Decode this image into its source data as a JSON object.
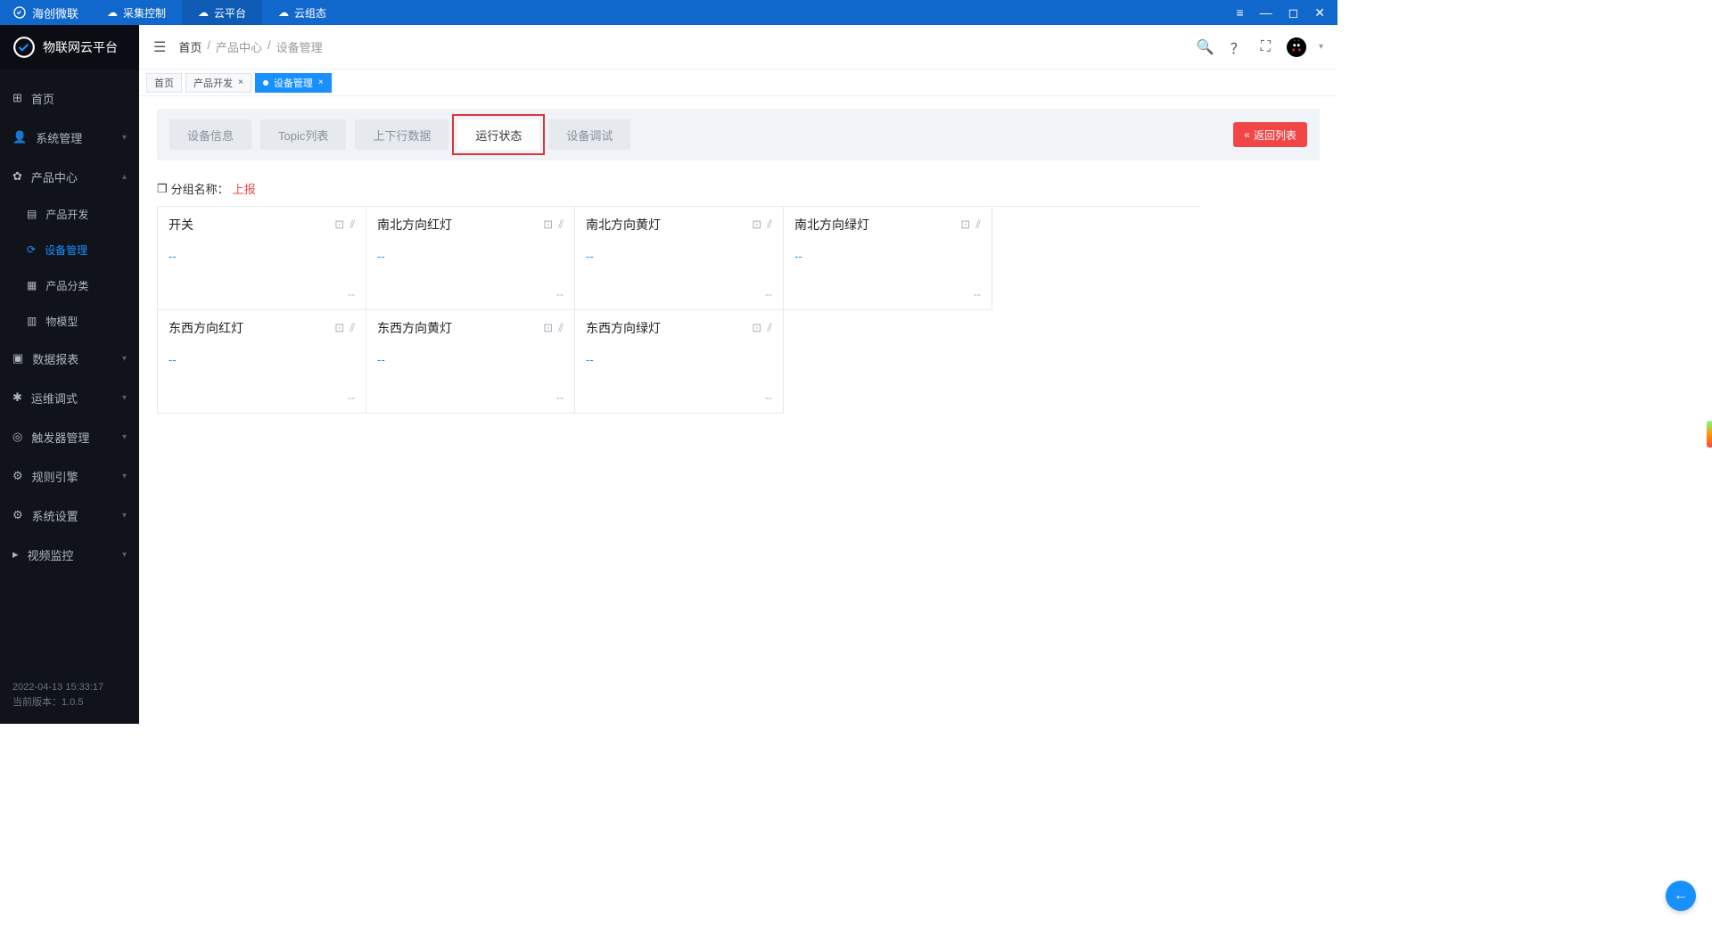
{
  "titlebar": {
    "brand": "海创微联",
    "tabs": [
      {
        "label": "采集控制"
      },
      {
        "label": "云平台",
        "active": true
      },
      {
        "label": "云组态"
      }
    ]
  },
  "sidebar": {
    "logo": "物联网云平台",
    "menu": [
      {
        "label": "首页",
        "icon": "dashboard"
      },
      {
        "label": "系统管理",
        "icon": "user",
        "caret": "down"
      },
      {
        "label": "产品中心",
        "icon": "gear",
        "caret": "up",
        "sub": [
          {
            "label": "产品开发",
            "icon": "list"
          },
          {
            "label": "设备管理",
            "icon": "refresh",
            "active": true
          },
          {
            "label": "产品分类",
            "icon": "grid"
          },
          {
            "label": "物模型",
            "icon": "table"
          }
        ]
      },
      {
        "label": "数据报表",
        "icon": "report",
        "caret": "down"
      },
      {
        "label": "运维调式",
        "icon": "wrench",
        "caret": "down"
      },
      {
        "label": "触发器管理",
        "icon": "trigger",
        "caret": "down"
      },
      {
        "label": "规则引擎",
        "icon": "rule",
        "caret": "down"
      },
      {
        "label": "系统设置",
        "icon": "cog",
        "caret": "down"
      },
      {
        "label": "视频监控",
        "icon": "camera",
        "caret": "down"
      }
    ],
    "footer": {
      "time": "2022-04-13 15:33:17",
      "version": "当前版本：1.0.5"
    }
  },
  "crumb": [
    "首页",
    "产品中心",
    "设备管理"
  ],
  "pagetabs": [
    {
      "label": "首页",
      "closable": false
    },
    {
      "label": "产品开发",
      "closable": true
    },
    {
      "label": "设备管理",
      "closable": true,
      "active": true
    }
  ],
  "innertabs": [
    {
      "label": "设备信息"
    },
    {
      "label": "Topic列表"
    },
    {
      "label": "上下行数据"
    },
    {
      "label": "运行状态",
      "active": true,
      "highlight": true
    },
    {
      "label": "设备调试"
    }
  ],
  "back_button": "返回列表",
  "group": {
    "label": "分组名称：",
    "value": "上报"
  },
  "cards": [
    {
      "title": "开关",
      "value": "--",
      "footer": "--"
    },
    {
      "title": "南北方向红灯",
      "value": "--",
      "footer": "--"
    },
    {
      "title": "南北方向黄灯",
      "value": "--",
      "footer": "--"
    },
    {
      "title": "南北方向绿灯",
      "value": "--",
      "footer": "--"
    },
    {
      "title": "东西方向红灯",
      "value": "--",
      "footer": "--"
    },
    {
      "title": "东西方向黄灯",
      "value": "--",
      "footer": "--"
    },
    {
      "title": "东西方向绿灯",
      "value": "--",
      "footer": "--"
    }
  ]
}
